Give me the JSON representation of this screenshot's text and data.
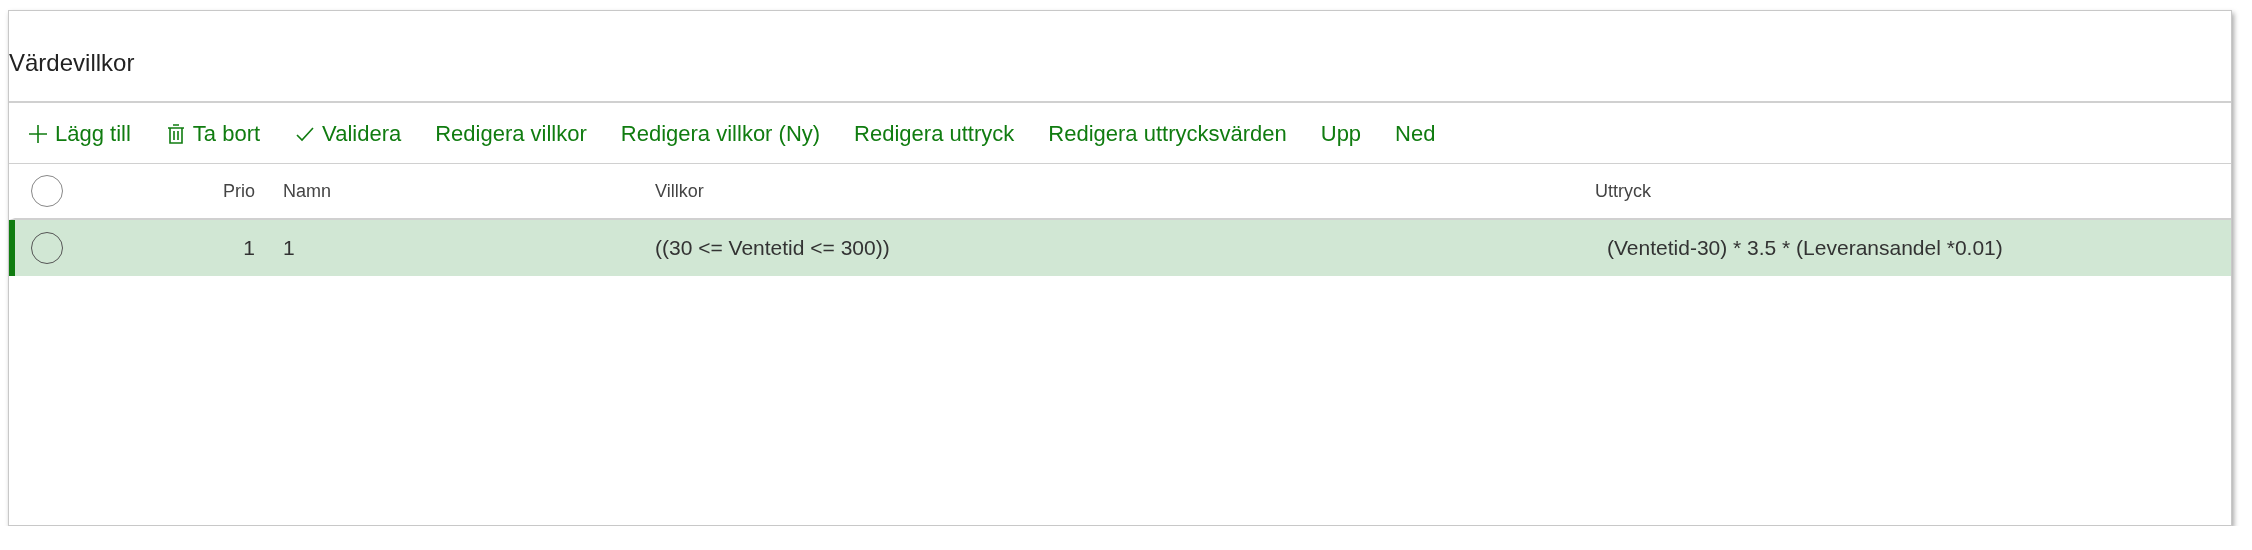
{
  "panel": {
    "title": "Värdevillkor"
  },
  "toolbar": [
    {
      "label": "Lägg till",
      "kind": "add"
    },
    {
      "label": "Ta bort",
      "kind": "delete"
    },
    {
      "label": "Validera",
      "kind": "validate"
    },
    {
      "label": "Redigera villkor",
      "kind": "text"
    },
    {
      "label": "Redigera villkor (Ny)",
      "kind": "text"
    },
    {
      "label": "Redigera uttryck",
      "kind": "text"
    },
    {
      "label": "Redigera uttrycksvärden",
      "kind": "text"
    },
    {
      "label": "Upp",
      "kind": "text"
    },
    {
      "label": "Ned",
      "kind": "text"
    }
  ],
  "table": {
    "all_selected": false,
    "columns": [
      "Prio",
      "Namn",
      "Villkor",
      "Uttryck"
    ],
    "rows": [
      {
        "selected": true,
        "cells": [
          "1",
          "1",
          "((30 <= Ventetid <= 300))",
          "(Ventetid-30) * 3.5 * (Leveransandel *0.01)"
        ]
      }
    ]
  }
}
